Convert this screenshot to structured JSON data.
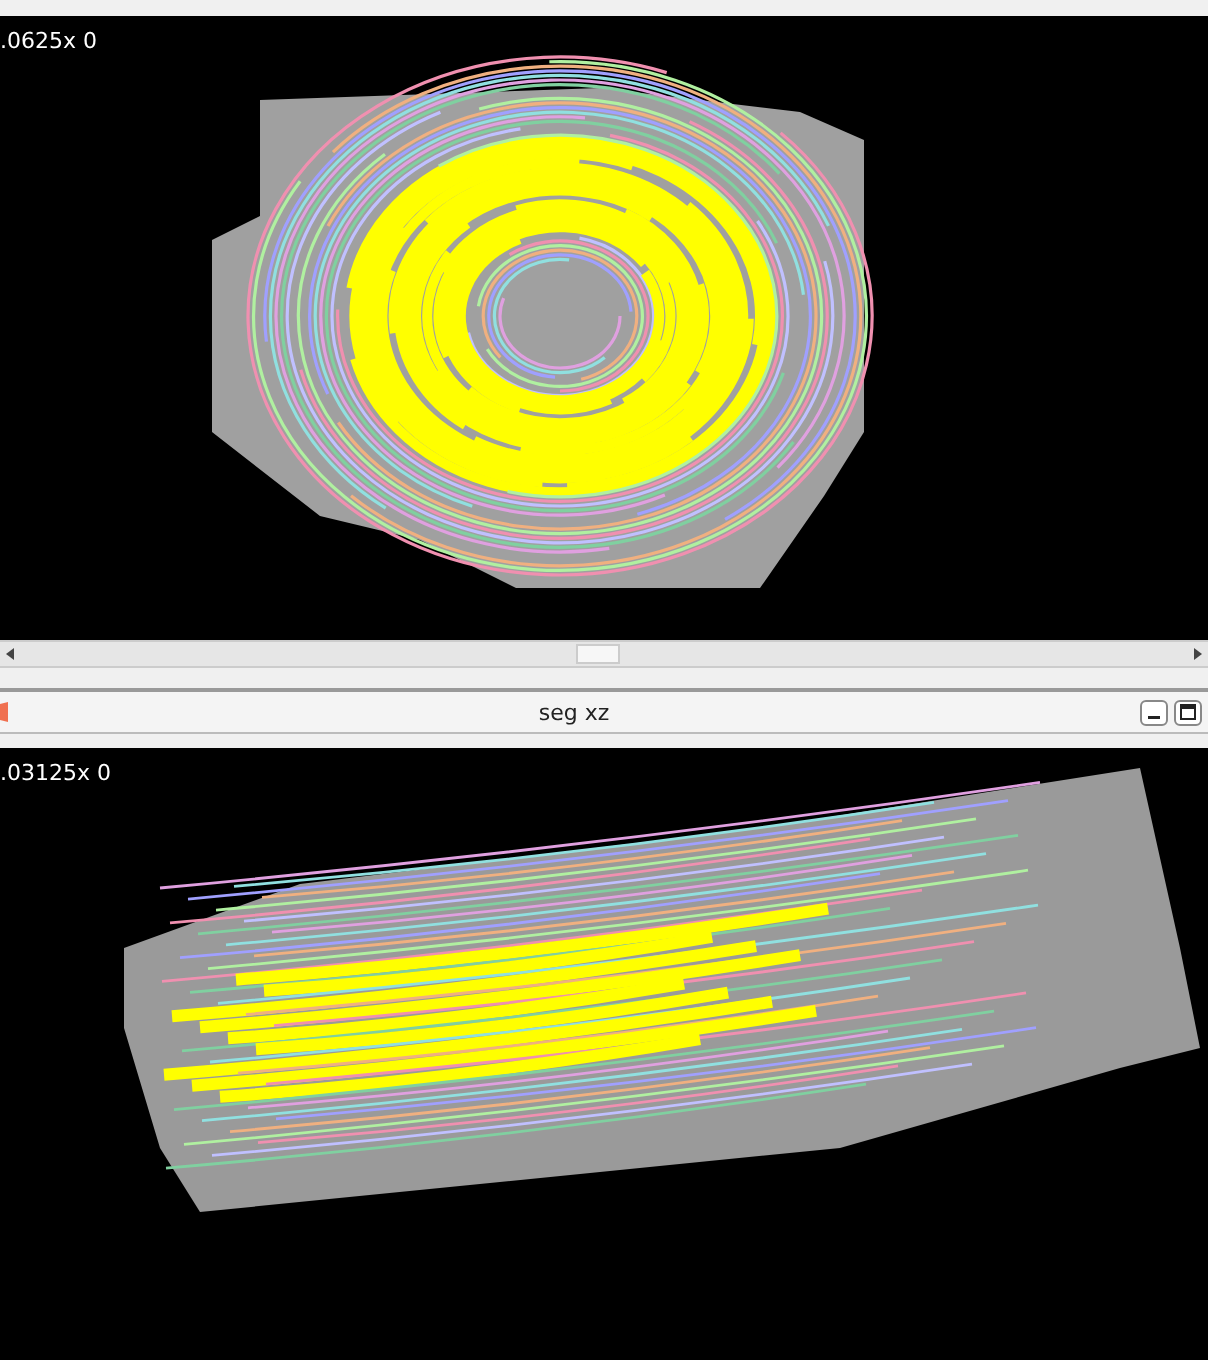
{
  "views": [
    {
      "kind": "axial",
      "zoom_label": ".0625x 0"
    },
    {
      "kind": "longitudinal",
      "title": "seg xz",
      "zoom_label": ".03125x 0"
    }
  ]
}
